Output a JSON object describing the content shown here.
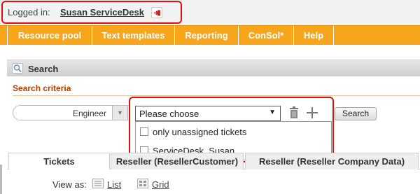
{
  "header": {
    "logged_in_label": "Logged in:",
    "user_name": "Susan ServiceDesk"
  },
  "nav": {
    "items": [
      "Resource pool",
      "Text templates",
      "Reporting",
      "ConSol*",
      "Help"
    ]
  },
  "search_panel": {
    "title": "Search",
    "criteria_title": "Search criteria",
    "engineer_select": {
      "value": "Engineer"
    },
    "criteria_dropdown": {
      "value": "Please choose",
      "options": [
        {
          "label": "only unassigned tickets",
          "checked": false
        },
        {
          "label": "ServiceDesk, Susan",
          "checked": false
        }
      ]
    },
    "search_button": "Search"
  },
  "tabs": [
    {
      "label": "Tickets",
      "active": true
    },
    {
      "label": "Reseller (ResellerCustomer)",
      "active": false
    },
    {
      "label": "Reseller (Reseller Company Data)",
      "active": false
    }
  ],
  "view_as": {
    "label": "View as:",
    "list_label": "List",
    "grid_label": "Grid"
  },
  "colors": {
    "nav_bg": "#f7a51a",
    "highlight": "#e01010",
    "section_title": "#b34000"
  }
}
